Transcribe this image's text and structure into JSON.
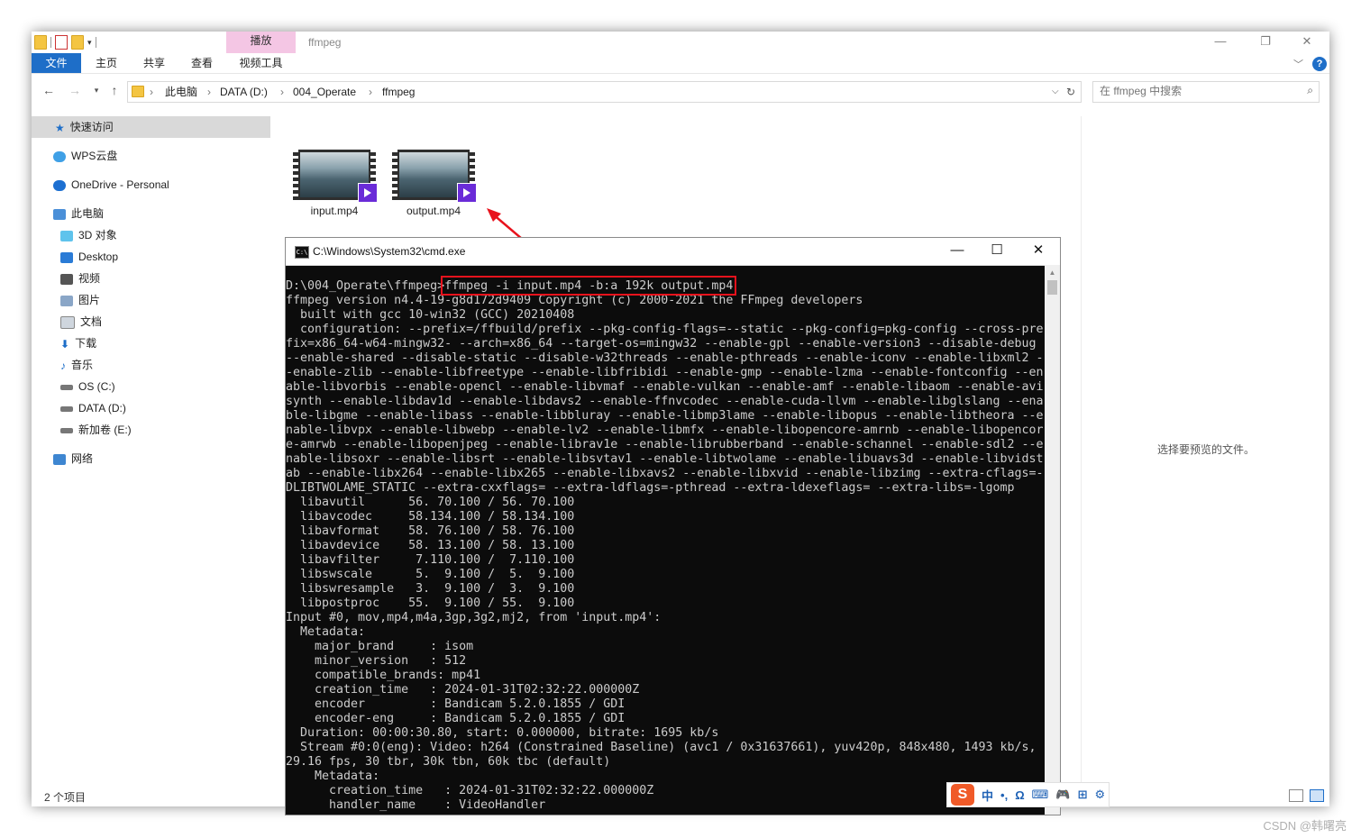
{
  "window": {
    "folder_title": "ffmpeg",
    "context_tab_header": "播放",
    "controls": {
      "minimize": "—",
      "maximize": "❐",
      "close": "✕"
    }
  },
  "ribbon": {
    "tabs": [
      "文件",
      "主页",
      "共享",
      "查看",
      "视频工具"
    ],
    "help": "?"
  },
  "address": {
    "crumbs": [
      "此电脑",
      "DATA (D:)",
      "004_Operate",
      "ffmpeg"
    ],
    "search_placeholder": "在 ffmpeg 中搜索"
  },
  "nav": {
    "items": [
      {
        "label": "快速访问",
        "icon": "star-icon"
      },
      {
        "label": "WPS云盘",
        "icon": "cloud-icon"
      },
      {
        "label": "OneDrive - Personal",
        "icon": "onedrive-icon"
      },
      {
        "label": "此电脑",
        "icon": "computer-icon"
      },
      {
        "label": "3D 对象",
        "icon": "cube-icon"
      },
      {
        "label": "Desktop",
        "icon": "desktop-icon"
      },
      {
        "label": "视频",
        "icon": "video-folder-icon"
      },
      {
        "label": "图片",
        "icon": "pictures-folder-icon"
      },
      {
        "label": "文档",
        "icon": "documents-folder-icon"
      },
      {
        "label": "下载",
        "icon": "download-icon"
      },
      {
        "label": "音乐",
        "icon": "music-icon"
      },
      {
        "label": "OS (C:)",
        "icon": "drive-c-icon"
      },
      {
        "label": "DATA (D:)",
        "icon": "drive-icon"
      },
      {
        "label": "新加卷 (E:)",
        "icon": "drive-icon"
      },
      {
        "label": "网络",
        "icon": "network-icon"
      }
    ]
  },
  "files": [
    {
      "name": "input.mp4",
      "icon": "video-file-icon"
    },
    {
      "name": "output.mp4",
      "icon": "video-file-icon"
    }
  ],
  "preview_message": "选择要预览的文件。",
  "status": {
    "item_count": "2 个项目"
  },
  "cmd": {
    "title": "C:\\Windows\\System32\\cmd.exe",
    "icon_text": "C:\\",
    "highlighted_command": "ffmpeg -i input.mp4 -b:a 192k output.mp4",
    "output": "D:\\004_Operate\\ffmpeg>ffmpeg -i input.mp4 -b:a 192k output.mp4\nffmpeg version n4.4-19-g8d172d9409 Copyright (c) 2000-2021 the FFmpeg developers\n  built with gcc 10-win32 (GCC) 20210408\n  configuration: --prefix=/ffbuild/prefix --pkg-config-flags=--static --pkg-config=pkg-config --cross-pre\nfix=x86_64-w64-mingw32- --arch=x86_64 --target-os=mingw32 --enable-gpl --enable-version3 --disable-debug\n--enable-shared --disable-static --disable-w32threads --enable-pthreads --enable-iconv --enable-libxml2 -\n-enable-zlib --enable-libfreetype --enable-libfribidi --enable-gmp --enable-lzma --enable-fontconfig --en\nable-libvorbis --enable-opencl --enable-libvmaf --enable-vulkan --enable-amf --enable-libaom --enable-avi\nsynth --enable-libdav1d --enable-libdavs2 --enable-ffnvcodec --enable-cuda-llvm --enable-libglslang --ena\nble-libgme --enable-libass --enable-libbluray --enable-libmp3lame --enable-libopus --enable-libtheora --e\nnable-libvpx --enable-libwebp --enable-lv2 --enable-libmfx --enable-libopencore-amrnb --enable-libopencor\ne-amrwb --enable-libopenjpeg --enable-librav1e --enable-librubberband --enable-schannel --enable-sdl2 --e\nnable-libsoxr --enable-libsrt --enable-libsvtav1 --enable-libtwolame --enable-libuavs3d --enable-libvidst\nab --enable-libx264 --enable-libx265 --enable-libxavs2 --enable-libxvid --enable-libzimg --extra-cflags=-\nDLIBTWOLAME_STATIC --extra-cxxflags= --extra-ldflags=-pthread --extra-ldexeflags= --extra-libs=-lgomp\n  libavutil      56. 70.100 / 56. 70.100\n  libavcodec     58.134.100 / 58.134.100\n  libavformat    58. 76.100 / 58. 76.100\n  libavdevice    58. 13.100 / 58. 13.100\n  libavfilter     7.110.100 /  7.110.100\n  libswscale      5.  9.100 /  5.  9.100\n  libswresample   3.  9.100 /  3.  9.100\n  libpostproc    55.  9.100 / 55.  9.100\nInput #0, mov,mp4,m4a,3gp,3g2,mj2, from 'input.mp4':\n  Metadata:\n    major_brand     : isom\n    minor_version   : 512\n    compatible_brands: mp41\n    creation_time   : 2024-01-31T02:32:22.000000Z\n    encoder         : Bandicam 5.2.0.1855 / GDI\n    encoder-eng     : Bandicam 5.2.0.1855 / GDI\n  Duration: 00:00:30.80, start: 0.000000, bitrate: 1695 kb/s\n  Stream #0:0(eng): Video: h264 (Constrained Baseline) (avc1 / 0x31637661), yuv420p, 848x480, 1493 kb/s,\n29.16 fps, 30 tbr, 30k tbn, 60k tbc (default)\n    Metadata:\n      creation_time   : 2024-01-31T02:32:22.000000Z\n      handler_name    : VideoHandler"
  },
  "ime": {
    "logo": "S",
    "items": [
      "中",
      "•,",
      "Ω",
      "⌨",
      "🎮",
      "⊞",
      "⚙"
    ]
  },
  "watermark": "CSDN @韩曙亮",
  "colors": {
    "accent": "#1e6ec8",
    "highlight": "#e8121c",
    "console_bg": "#0c0c0c",
    "console_fg": "#cccccc"
  }
}
